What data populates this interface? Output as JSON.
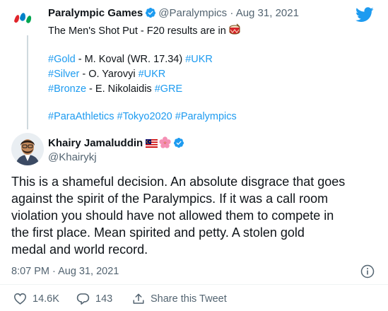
{
  "parent_tweet": {
    "author_name": "Paralympic Games",
    "author_handle": "@Paralympics",
    "separator": "·",
    "date": "Aug 31, 2021",
    "text": "The Men's Shot Put - F20 results are in",
    "results": {
      "gold_tag": "#Gold",
      "gold_rest": " - M. Koval (WR. 17.34) ",
      "gold_country": "#UKR",
      "silver_tag": "#Silver",
      "silver_rest": " - O. Yarovyi ",
      "silver_country": "#UKR",
      "bronze_tag": "#Bronze",
      "bronze_rest": " - E. Nikolaidis ",
      "bronze_country": "#GRE"
    },
    "hashtags": "#ParaAthletics #Tokyo2020 #Paralympics"
  },
  "main_tweet": {
    "author_name": "Khairy Jamaluddin",
    "author_handle": "@Khairykj",
    "body_lines": [
      "This is a shameful decision. An absolute disgrace that goes",
      "against the spirit of the Paralympics. If it was a call room",
      "violation you should have not allowed them to compete in",
      "the first place. Mean spirited and petty. A stolen gold",
      "medal and world record."
    ],
    "timestamp": "8:07 PM · Aug 31, 2021"
  },
  "actions": {
    "likes": "14.6K",
    "replies": "143",
    "share_label": "Share this Tweet"
  },
  "colors": {
    "accent": "#1d9bf0",
    "text": "#0f1419",
    "secondary": "#536471",
    "like_icon": "#536471"
  },
  "icons": [
    "paralympics-logo-icon",
    "verified-icon",
    "twitter-bird-icon",
    "drum-icon",
    "malaysia-flag-icon",
    "hibiscus-icon",
    "info-icon",
    "heart-icon",
    "reply-icon",
    "share-icon"
  ]
}
